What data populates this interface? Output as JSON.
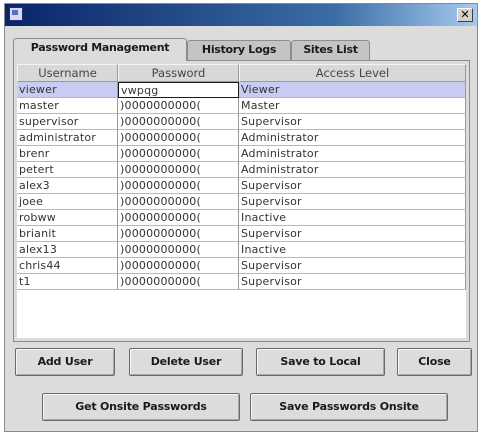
{
  "window": {
    "close_glyph": "✕",
    "icon": "java-app-icon"
  },
  "tabs": [
    {
      "label": "Password Management",
      "active": true
    },
    {
      "label": "History Logs",
      "active": false
    },
    {
      "label": "Sites List",
      "active": false
    }
  ],
  "table": {
    "columns": [
      "Username",
      "Password",
      "Access Level"
    ],
    "rows": [
      {
        "username": "viewer",
        "password": "vwpqg",
        "access": "Viewer",
        "selected": true
      },
      {
        "username": "master",
        "password": ")0000000000(",
        "access": "Master"
      },
      {
        "username": "supervisor",
        "password": ")0000000000(",
        "access": "Supervisor"
      },
      {
        "username": "administrator",
        "password": ")0000000000(",
        "access": "Administrator"
      },
      {
        "username": "brenr",
        "password": ")0000000000(",
        "access": "Administrator"
      },
      {
        "username": "petert",
        "password": ")0000000000(",
        "access": "Administrator"
      },
      {
        "username": "alex3",
        "password": ")0000000000(",
        "access": "Supervisor"
      },
      {
        "username": "joee",
        "password": ")0000000000(",
        "access": "Supervisor"
      },
      {
        "username": "robww",
        "password": ")0000000000(",
        "access": "Inactive"
      },
      {
        "username": "brianit",
        "password": ")0000000000(",
        "access": "Supervisor"
      },
      {
        "username": "alex13",
        "password": ")0000000000(",
        "access": "Inactive"
      },
      {
        "username": "chris44",
        "password": ")0000000000(",
        "access": "Supervisor"
      },
      {
        "username": "t1",
        "password": ")0000000000(",
        "access": "Supervisor"
      }
    ]
  },
  "buttons": {
    "add_user": "Add User",
    "delete_user": "Delete User",
    "save_local": "Save to Local",
    "close": "Close",
    "get_onsite": "Get Onsite Passwords",
    "save_onsite": "Save Passwords Onsite"
  },
  "colors": {
    "title_start": "#0a246a",
    "title_end": "#a6caf0",
    "selection": "#c8cbf2"
  }
}
